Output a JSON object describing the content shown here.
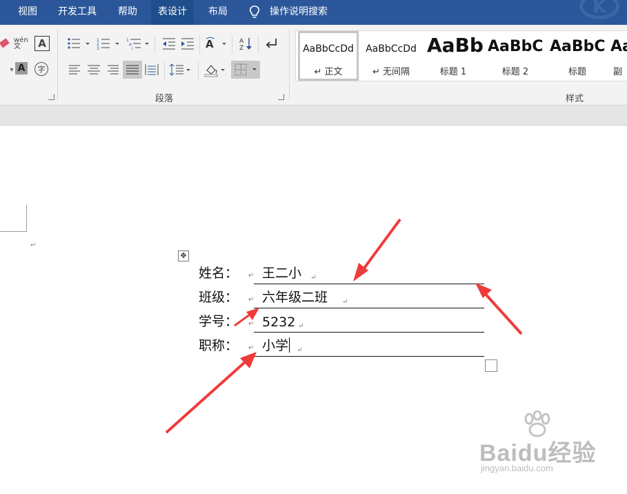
{
  "tabs": [
    {
      "label": "视图",
      "active": false
    },
    {
      "label": "开发工具",
      "active": false
    },
    {
      "label": "帮助",
      "active": false
    },
    {
      "label": "表设计",
      "active": true
    },
    {
      "label": "布局",
      "active": false
    }
  ],
  "tell_me": {
    "label": "操作说明搜索",
    "icon": "lightbulb-icon"
  },
  "ribbon": {
    "paragraph_group_label": "段落",
    "styles_group_label": "样式",
    "font_icons": [
      "eraser-icon",
      "phonetic-guide-icon",
      "character-border-icon",
      "character-shading-icon",
      "enclose-character-icon"
    ],
    "phonetic_icon_text": "wén文",
    "char_border_text": "A",
    "char_shading_text": "A",
    "enclose_text": "字",
    "paragraph_icons": [
      "bullets-icon",
      "numbering-icon",
      "multilevel-list-icon",
      "decrease-indent-icon",
      "increase-indent-icon",
      "chinese-layout-icon",
      "sort-icon",
      "show-marks-icon",
      "align-left-icon",
      "center-icon",
      "align-right-icon",
      "justify-icon",
      "distributed-icon",
      "line-spacing-icon",
      "shading-icon",
      "borders-icon"
    ],
    "styles": [
      {
        "sample": "AaBbCcDd",
        "name": "正文",
        "selected": true
      },
      {
        "sample": "AaBbCcDd",
        "name": "无间隔",
        "selected": false
      },
      {
        "sample": "AaBb",
        "name": "标题 1",
        "selected": false
      },
      {
        "sample": "AaBbC",
        "name": "标题 2",
        "selected": false
      },
      {
        "sample": "AaBbC",
        "name": "标题",
        "selected": false
      },
      {
        "sample": "Aa",
        "name": "副",
        "selected": false
      }
    ]
  },
  "document": {
    "paragraph_mark": "↵",
    "move_handle_glyph": "✥",
    "rows": [
      {
        "label": "姓名：",
        "value": "王二小"
      },
      {
        "label": "班级：",
        "value": "六年级二班"
      },
      {
        "label": "学号：",
        "value": "5232"
      },
      {
        "label": "职称：",
        "value": "小学"
      }
    ]
  },
  "watermark": {
    "brand": "Baidu经验",
    "url": "jingyan.baidu.com"
  },
  "colors": {
    "title_bar": "#2b579a",
    "active_tab": "#1e4e8c",
    "arrow": "#ef3b3b"
  }
}
